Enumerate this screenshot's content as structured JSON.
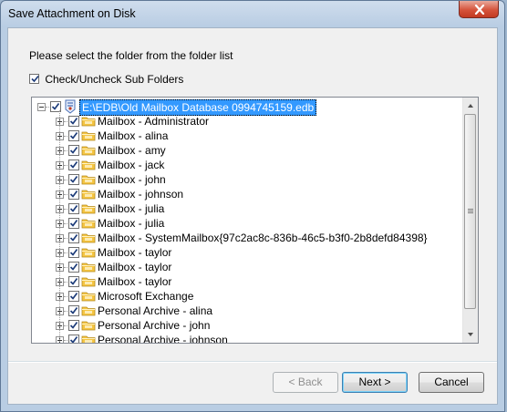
{
  "window": {
    "title": "Save Attachment on Disk"
  },
  "dialog": {
    "prompt": "Please select the folder from the folder list",
    "subfolders_label": "Check/Uncheck Sub Folders",
    "subfolders_checked": true
  },
  "tree": {
    "root": {
      "label": "E:\\EDB\\Old Mailbox Database 0994745159.edb",
      "checked": true,
      "selected": true,
      "icon": "database-icon"
    },
    "items": [
      {
        "label": "Mailbox - Administrator",
        "checked": true,
        "icon": "folder-icon"
      },
      {
        "label": "Mailbox - alina",
        "checked": true,
        "icon": "folder-icon"
      },
      {
        "label": "Mailbox - amy",
        "checked": true,
        "icon": "folder-icon"
      },
      {
        "label": "Mailbox - jack",
        "checked": true,
        "icon": "folder-icon"
      },
      {
        "label": "Mailbox - john",
        "checked": true,
        "icon": "folder-icon"
      },
      {
        "label": "Mailbox - johnson",
        "checked": true,
        "icon": "folder-icon"
      },
      {
        "label": "Mailbox - julia",
        "checked": true,
        "icon": "folder-icon"
      },
      {
        "label": "Mailbox - julia",
        "checked": true,
        "icon": "folder-icon"
      },
      {
        "label": "Mailbox - SystemMailbox{97c2ac8c-836b-46c5-b3f0-2b8defd84398}",
        "checked": true,
        "icon": "folder-icon"
      },
      {
        "label": "Mailbox - taylor",
        "checked": true,
        "icon": "folder-icon"
      },
      {
        "label": "Mailbox - taylor",
        "checked": true,
        "icon": "folder-icon"
      },
      {
        "label": "Mailbox - taylor",
        "checked": true,
        "icon": "folder-icon"
      },
      {
        "label": "Microsoft Exchange",
        "checked": true,
        "icon": "folder-icon"
      },
      {
        "label": "Personal Archive - alina",
        "checked": true,
        "icon": "folder-icon"
      },
      {
        "label": "Personal Archive - john",
        "checked": true,
        "icon": "folder-icon"
      },
      {
        "label": "Personal Archive - johnson",
        "checked": true,
        "icon": "folder-icon"
      }
    ]
  },
  "buttons": {
    "back": "< Back",
    "next": "Next >",
    "cancel": "Cancel"
  },
  "colors": {
    "selection": "#3399ff",
    "folder": "#f5c542"
  }
}
